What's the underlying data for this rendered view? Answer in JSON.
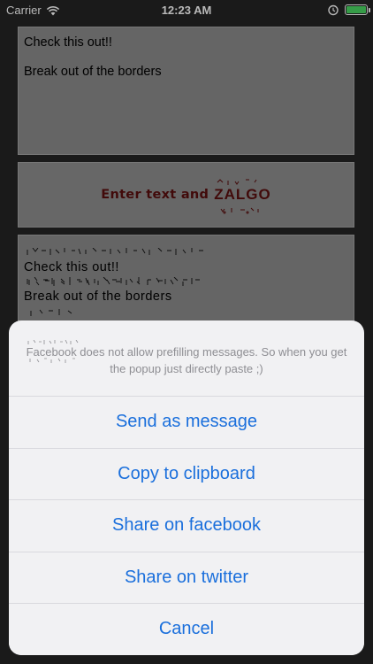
{
  "status_bar": {
    "carrier": "Carrier",
    "time": "12:23 AM",
    "battery_level": 1.0,
    "battery_color": "#4cd964"
  },
  "input_panel": {
    "lines": [
      "Check this out!!",
      "Break out of the borders"
    ]
  },
  "banner": {
    "text": "Enter text and",
    "brand": "ZALGO",
    "color": "#5a0e0e"
  },
  "output_panel": {
    "lines": [
      "Check this out!!",
      "Break out of the borders"
    ]
  },
  "action_sheet": {
    "message": "Facebook does not allow prefilling messages. So when you get the popup just directly paste ;)",
    "actions": [
      "Send as message",
      "Copy to clipboard",
      "Share on facebook",
      "Share on twitter",
      "Cancel"
    ],
    "action_color": "#1a6fdc"
  }
}
